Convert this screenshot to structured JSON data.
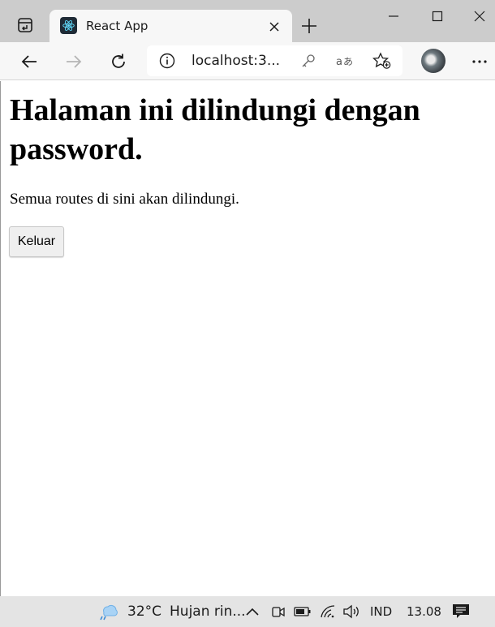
{
  "browser": {
    "tab": {
      "title": "React App"
    },
    "address": {
      "url": "localhost:3..."
    }
  },
  "page": {
    "title": "Halaman ini dilindungi dengan password.",
    "description": "Semua routes di sini akan dilindungi.",
    "logout_label": "Keluar"
  },
  "taskbar": {
    "temperature": "32°C",
    "weather": "Hujan rin...",
    "language": "IND",
    "time": "13.08"
  }
}
